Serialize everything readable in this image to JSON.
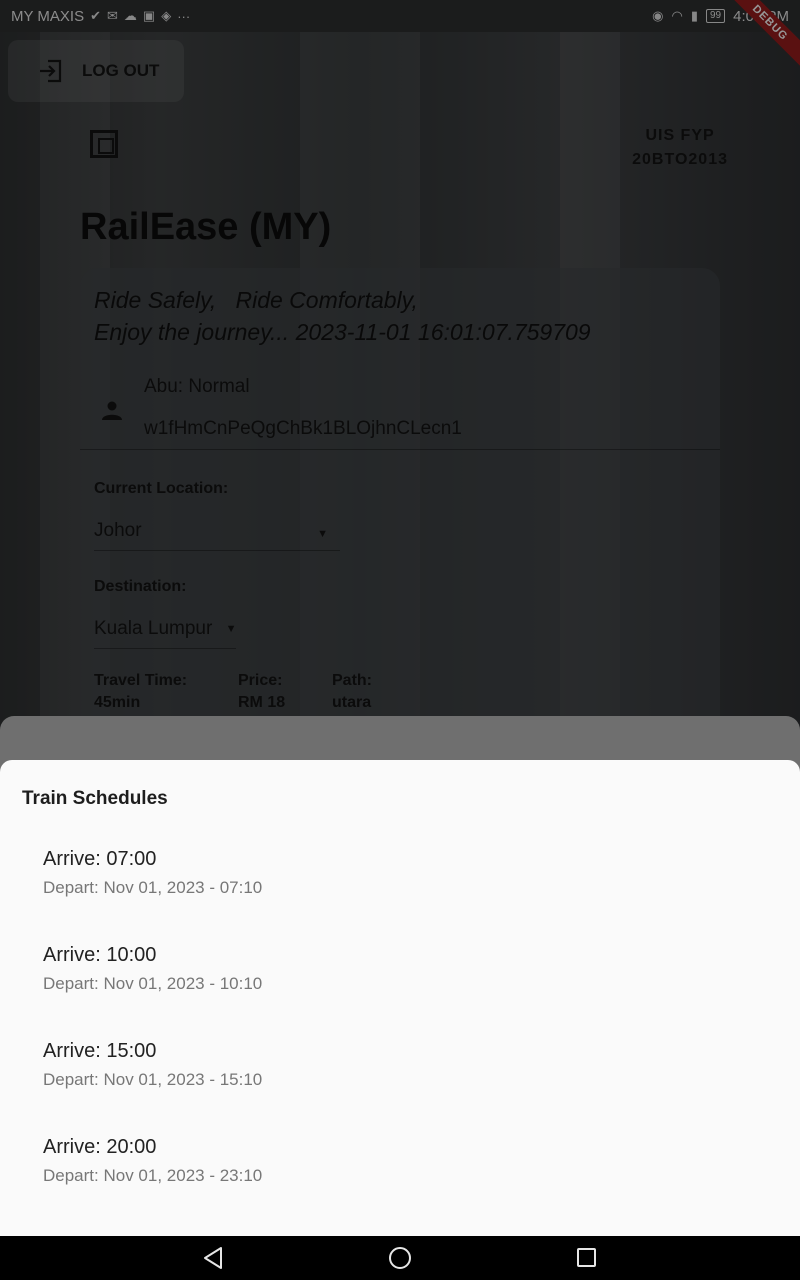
{
  "status_bar": {
    "carrier": "MY MAXIS",
    "notification_icons": [
      "check-icon",
      "mail-icon",
      "cloud-icon",
      "shop-icon",
      "shield-icon",
      "more-icon"
    ],
    "battery": "99",
    "time": "4:01 PM"
  },
  "debug_ribbon": "DEBUG",
  "header": {
    "logout_label": "LOG OUT",
    "fyp_line1": "UIS FYP",
    "fyp_line2": "20BTO2013",
    "app_title": "RailEase (MY)"
  },
  "card": {
    "tagline_line1": "Ride Safely,   Ride Comfortably,",
    "tagline_line2": "Enjoy the journey... 2023-11-01 16:01:07.759709",
    "user_name": "Abu: Normal",
    "user_id": "w1fHmCnPeQgChBk1BLOjhnCLecn1",
    "current_location_label": "Current Location:",
    "current_location_value": "Johor",
    "destination_label": "Destination:",
    "destination_value": "Kuala Lumpur",
    "travel_time_label": "Travel Time:",
    "travel_time_value": "45min",
    "price_label": "Price:",
    "price_value": "RM 18",
    "path_label": "Path:",
    "path_value": "utara"
  },
  "sheet": {
    "title": "Train Schedules",
    "schedules": [
      {
        "arrive": "Arrive: 07:00",
        "depart": "Depart: Nov 01, 2023 - 07:10"
      },
      {
        "arrive": "Arrive: 10:00",
        "depart": "Depart: Nov 01, 2023 - 10:10"
      },
      {
        "arrive": "Arrive: 15:00",
        "depart": "Depart: Nov 01, 2023 - 15:10"
      },
      {
        "arrive": "Arrive: 20:00",
        "depart": "Depart: Nov 01, 2023 - 23:10"
      }
    ]
  },
  "nav_icons": [
    "back-icon",
    "home-icon",
    "recents-icon"
  ]
}
